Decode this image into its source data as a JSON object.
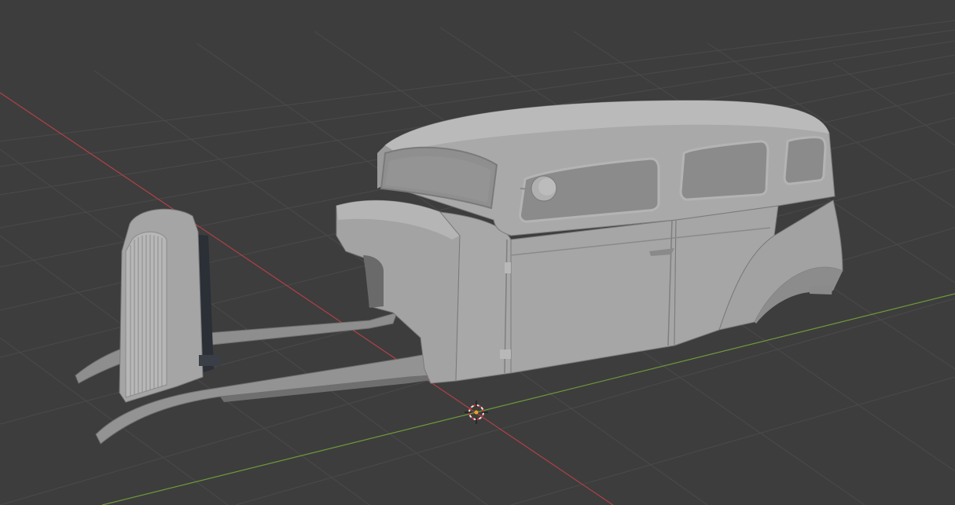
{
  "viewport": {
    "background_color": "#3d3d3d",
    "grid_color": "#4a4a4a",
    "x_axis_color": "#b04048",
    "y_axis_color": "#6e9a3a",
    "model_color": "#9a9a9a",
    "model_shadow_color": "#6e6e6e",
    "model_highlight_color": "#b3b3b3",
    "icons": [
      "3d-cursor-icon"
    ]
  }
}
